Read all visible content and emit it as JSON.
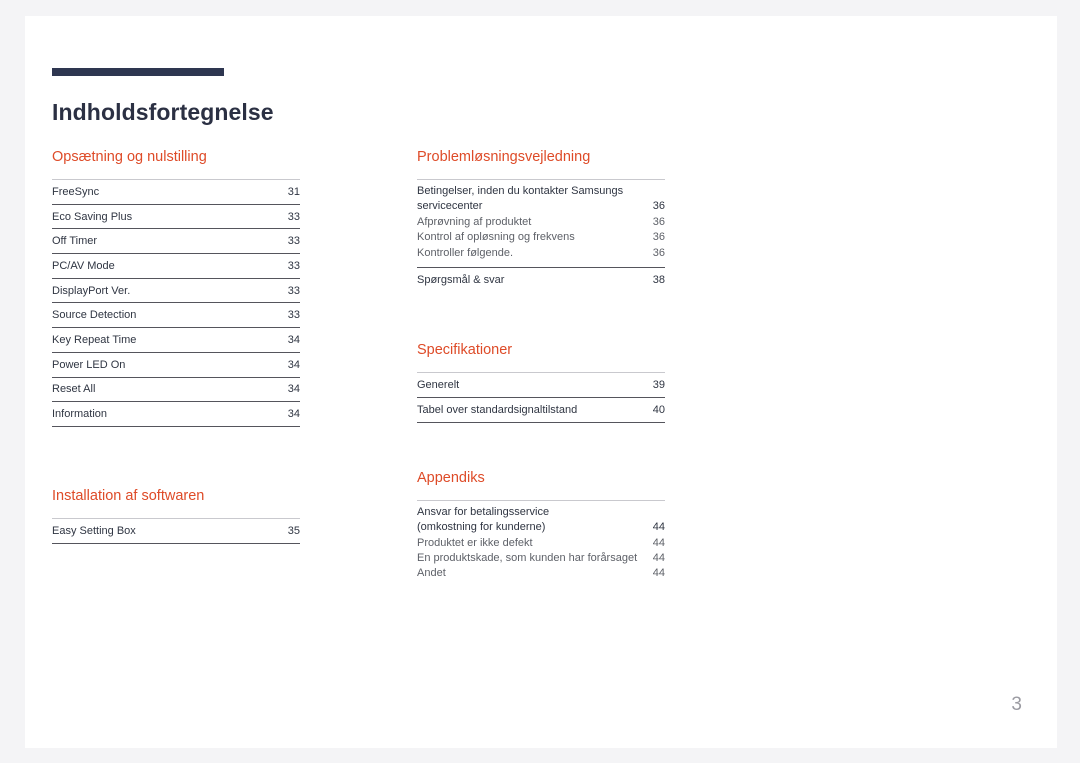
{
  "document": {
    "title": "Indholdsfortegnelse",
    "page_number": "3",
    "accent_heading_color": "#de4b28",
    "title_rule_color": "#2e3650"
  },
  "left_column": {
    "sections": [
      {
        "heading": "Opsætning og nulstilling",
        "style": "rows",
        "entries": [
          {
            "label": "FreeSync",
            "page": "31"
          },
          {
            "label": "Eco Saving Plus",
            "page": "33"
          },
          {
            "label": "Off Timer",
            "page": "33"
          },
          {
            "label": "PC/AV Mode",
            "page": "33"
          },
          {
            "label": "DisplayPort Ver.",
            "page": "33"
          },
          {
            "label": "Source Detection",
            "page": "33"
          },
          {
            "label": "Key Repeat Time",
            "page": "34"
          },
          {
            "label": "Power LED On",
            "page": "34"
          },
          {
            "label": "Reset All",
            "page": "34"
          },
          {
            "label": "Information",
            "page": "34"
          }
        ]
      },
      {
        "heading": "Installation af softwaren",
        "style": "rows",
        "entries": [
          {
            "label": "Easy Setting Box",
            "page": "35"
          }
        ]
      }
    ]
  },
  "right_column": {
    "sections": [
      {
        "heading": "Problemløsningsvejledning",
        "style": "groups",
        "groups": [
          {
            "lines": [
              {
                "label": "Betingelser, inden du kontakter Samsungs",
                "page": "",
                "level": "main"
              },
              {
                "label": "servicecenter",
                "page": "36",
                "level": "main"
              },
              {
                "label": "Afprøvning af produktet",
                "page": "36",
                "level": "sub"
              },
              {
                "label": "Kontrol af opløsning og frekvens",
                "page": "36",
                "level": "sub"
              },
              {
                "label": "Kontroller følgende.",
                "page": "36",
                "level": "sub"
              }
            ]
          },
          {
            "divided": true,
            "lines": [
              {
                "label": "Spørgsmål & svar",
                "page": "38",
                "level": "main"
              }
            ]
          }
        ]
      },
      {
        "heading": "Specifikationer",
        "style": "rows",
        "entries": [
          {
            "label": "Generelt",
            "page": "39"
          },
          {
            "label": "Tabel over standardsignaltilstand",
            "page": "40"
          }
        ]
      },
      {
        "heading": "Appendiks",
        "style": "groups",
        "groups": [
          {
            "lines": [
              {
                "label": "Ansvar for betalingsservice",
                "page": "",
                "level": "main"
              },
              {
                "label": "(omkostning for kunderne)",
                "page": "44",
                "level": "main"
              },
              {
                "label": "Produktet er ikke defekt",
                "page": "44",
                "level": "sub"
              },
              {
                "label": "En produktskade, som kunden har forårsaget",
                "page": "44",
                "level": "sub"
              },
              {
                "label": "Andet",
                "page": "44",
                "level": "sub"
              }
            ]
          }
        ]
      }
    ]
  }
}
